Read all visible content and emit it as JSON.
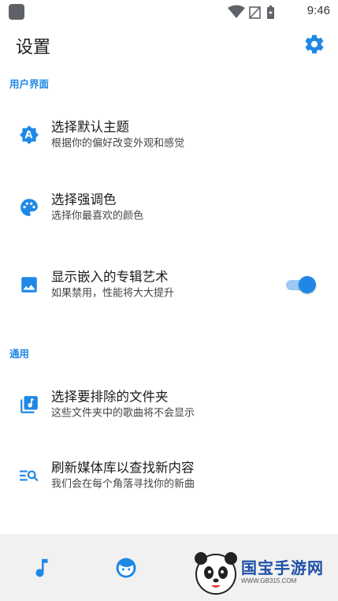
{
  "status_bar": {
    "time": "9:46"
  },
  "header": {
    "title": "设置"
  },
  "sections": [
    {
      "label": "用户界面"
    },
    {
      "label": "通用"
    }
  ],
  "items": [
    {
      "title": "选择默认主题",
      "subtitle": "根据你的偏好改变外观和感觉",
      "icon": "theme-icon"
    },
    {
      "title": "选择强调色",
      "subtitle": "选择你最喜欢的颜色",
      "icon": "palette-icon"
    },
    {
      "title": "显示嵌入的专辑艺术",
      "subtitle": "如果禁用，性能将大大提升",
      "icon": "image-icon",
      "toggle_on": true
    },
    {
      "title": "选择要排除的文件夹",
      "subtitle": "这些文件夹中的歌曲将不会显示",
      "icon": "music-library-icon"
    },
    {
      "title": "刷新媒体库以查找新内容",
      "subtitle": "我们会在每个角落寻找你的新曲",
      "icon": "search-list-icon"
    }
  ],
  "bottom_nav": [
    {
      "icon": "music-note-icon"
    },
    {
      "icon": "face-icon"
    }
  ],
  "watermark": {
    "brand": "国宝手游网",
    "url": "WWW.GB315.COM"
  },
  "colors": {
    "accent": "#1f88e5",
    "bottom_bar": "#f1f1f1"
  }
}
